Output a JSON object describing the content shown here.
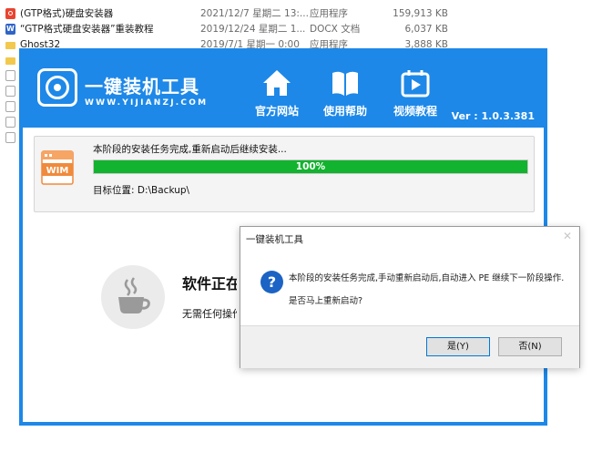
{
  "explorer": {
    "files": [
      {
        "icon": "exe-icon",
        "name": "(GTP格式)硬盘安装器",
        "date": "2021/12/7 星期二 13:...",
        "type": "应用程序",
        "size": "159,913 KB"
      },
      {
        "icon": "doc-icon",
        "name": "“GTP格式硬盘安装器”重装教程",
        "date": "2019/12/24 星期二 1...",
        "type": "DOCX 文档",
        "size": "6,037 KB"
      },
      {
        "icon": "folder-icon",
        "name": "Ghost32",
        "date": "2019/7/1 星期一 0:00",
        "type": "应用程序",
        "size": "3,888 KB"
      }
    ]
  },
  "app": {
    "title": "一键装机工具",
    "subtitle": "WWW.YIJIANZJ.COM",
    "nav": [
      {
        "label": "官方网站",
        "icon": "home-icon"
      },
      {
        "label": "使用帮助",
        "icon": "book-icon"
      },
      {
        "label": "视频教程",
        "icon": "video-icon"
      }
    ],
    "version": "Ver : 1.0.3.381",
    "status": {
      "message": "本阶段的安装任务完成,重新启动后继续安装...",
      "progress": 1.0,
      "progress_text": "100%",
      "target": "目标位置: D:\\Backup\\",
      "badge": "WIM"
    },
    "busy": {
      "title": "软件正在运行中",
      "subtitle": "无需任何操作,请耐心等待"
    },
    "accent_color": "#1d88e8",
    "progress_color": "#12b32e"
  },
  "dialog": {
    "title": "一键装机工具",
    "message": "本阶段的安装任务完成,手动重新启动后,自动进入 PE 继续下一阶段操作.",
    "question": "是否马上重新启动?",
    "yes": "是(Y)",
    "no": "否(N)"
  }
}
